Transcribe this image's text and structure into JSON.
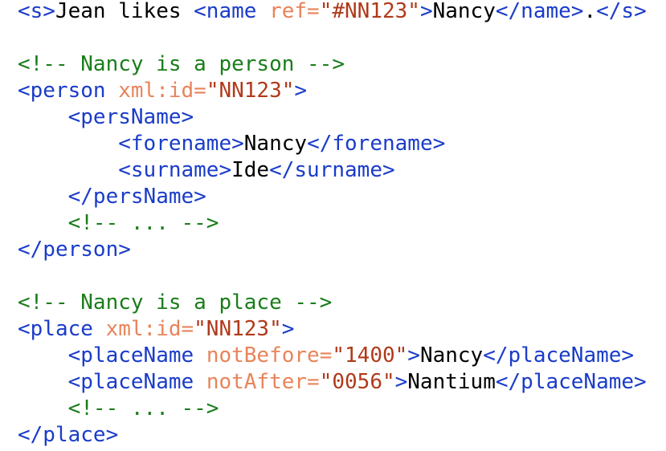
{
  "lines": [
    {
      "indent": "",
      "tokens": [
        {
          "t": "tag",
          "v": "<s>"
        },
        {
          "t": "txt",
          "v": "Jean likes "
        },
        {
          "t": "tag",
          "v": "<name "
        },
        {
          "t": "attr",
          "v": "ref="
        },
        {
          "t": "val",
          "v": "\"#NN123\""
        },
        {
          "t": "tag",
          "v": ">"
        },
        {
          "t": "txt",
          "v": "Nancy"
        },
        {
          "t": "tag",
          "v": "</name>"
        },
        {
          "t": "txt",
          "v": "."
        },
        {
          "t": "tag",
          "v": "</s>"
        }
      ]
    },
    {
      "indent": "",
      "tokens": []
    },
    {
      "indent": "",
      "tokens": [
        {
          "t": "cmt",
          "v": "<!-- Nancy is a person -->"
        }
      ]
    },
    {
      "indent": "",
      "tokens": [
        {
          "t": "tag",
          "v": "<person "
        },
        {
          "t": "attr",
          "v": "xml:id="
        },
        {
          "t": "val",
          "v": "\"NN123\""
        },
        {
          "t": "tag",
          "v": ">"
        }
      ]
    },
    {
      "indent": "    ",
      "tokens": [
        {
          "t": "tag",
          "v": "<persName>"
        }
      ]
    },
    {
      "indent": "        ",
      "tokens": [
        {
          "t": "tag",
          "v": "<forename>"
        },
        {
          "t": "txt",
          "v": "Nancy"
        },
        {
          "t": "tag",
          "v": "</forename>"
        }
      ]
    },
    {
      "indent": "        ",
      "tokens": [
        {
          "t": "tag",
          "v": "<surname>"
        },
        {
          "t": "txt",
          "v": "Ide"
        },
        {
          "t": "tag",
          "v": "</surname>"
        }
      ]
    },
    {
      "indent": "    ",
      "tokens": [
        {
          "t": "tag",
          "v": "</persName>"
        }
      ]
    },
    {
      "indent": "    ",
      "tokens": [
        {
          "t": "cmt",
          "v": "<!-- ... -->"
        }
      ]
    },
    {
      "indent": "",
      "tokens": [
        {
          "t": "tag",
          "v": "</person>"
        }
      ]
    },
    {
      "indent": "",
      "tokens": []
    },
    {
      "indent": "",
      "tokens": [
        {
          "t": "cmt",
          "v": "<!-- Nancy is a place -->"
        }
      ]
    },
    {
      "indent": "",
      "tokens": [
        {
          "t": "tag",
          "v": "<place "
        },
        {
          "t": "attr",
          "v": "xml:id="
        },
        {
          "t": "val",
          "v": "\"NN123\""
        },
        {
          "t": "tag",
          "v": ">"
        }
      ]
    },
    {
      "indent": "    ",
      "tokens": [
        {
          "t": "tag",
          "v": "<placeName "
        },
        {
          "t": "attr",
          "v": "notBefore="
        },
        {
          "t": "val",
          "v": "\"1400\""
        },
        {
          "t": "tag",
          "v": ">"
        },
        {
          "t": "txt",
          "v": "Nancy"
        },
        {
          "t": "tag",
          "v": "</placeName>"
        }
      ]
    },
    {
      "indent": "    ",
      "tokens": [
        {
          "t": "tag",
          "v": "<placeName "
        },
        {
          "t": "attr",
          "v": "notAfter="
        },
        {
          "t": "val",
          "v": "\"0056\""
        },
        {
          "t": "tag",
          "v": ">"
        },
        {
          "t": "txt",
          "v": "Nantium"
        },
        {
          "t": "tag",
          "v": "</placeName>"
        }
      ]
    },
    {
      "indent": "    ",
      "tokens": [
        {
          "t": "cmt",
          "v": "<!-- ... -->"
        }
      ]
    },
    {
      "indent": "",
      "tokens": [
        {
          "t": "tag",
          "v": "</place>"
        }
      ]
    }
  ]
}
